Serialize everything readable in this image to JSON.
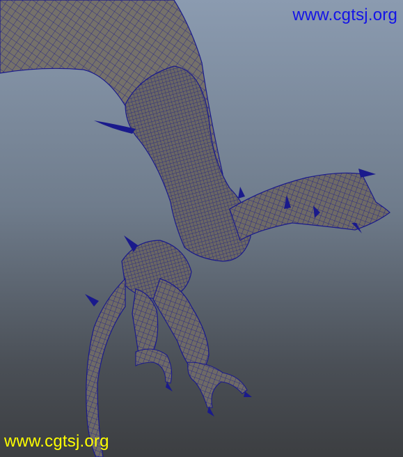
{
  "watermarks": {
    "top_right": "www.cgtsj.org",
    "bottom_left": "www.cgtsj.org"
  },
  "colors": {
    "background_top": "#8b9bb0",
    "background_bottom": "#3c3e41",
    "mesh_fill": "#6e6a66",
    "wireframe": "#1a1a8c",
    "watermark_top": "#1414e6",
    "watermark_bottom": "#ffff00"
  },
  "subject": {
    "icon": "dragon-wireframe-model"
  }
}
